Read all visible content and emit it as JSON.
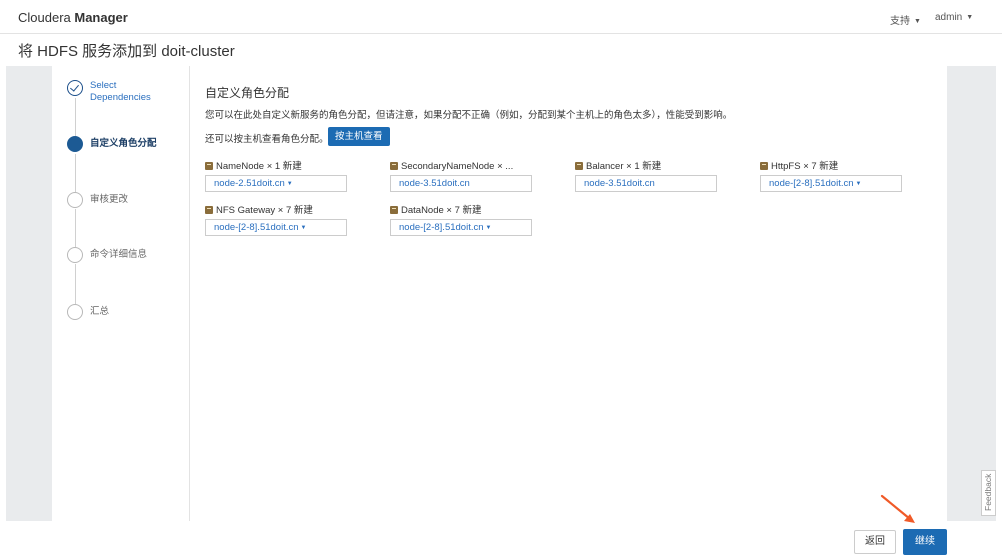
{
  "header": {
    "brand_light": "Cloudera ",
    "brand_bold": "Manager",
    "support_label": "支持",
    "user_label": "admin"
  },
  "page": {
    "title": "将 HDFS 服务添加到 doit-cluster"
  },
  "steps": [
    {
      "label_line1": "Select",
      "label_line2": "Dependencies",
      "state": "done"
    },
    {
      "label": "自定义角色分配",
      "state": "active"
    },
    {
      "label": "审核更改",
      "state": "pending"
    },
    {
      "label": "命令详细信息",
      "state": "pending"
    },
    {
      "label": "汇总",
      "state": "pending"
    }
  ],
  "content": {
    "section_title": "自定义角色分配",
    "description": "您可以在此处自定义新服务的角色分配，但请注意，如果分配不正确（例如，分配到某个主机上的角色太多），性能受到影响。",
    "host_view_text": "还可以按主机查看角色分配。",
    "host_view_button": "按主机查看"
  },
  "roles": [
    {
      "name": "NameNode × 1 新建",
      "host": "node-2.51doit.cn",
      "dropdown": true
    },
    {
      "name": "SecondaryNameNode × ...",
      "host": "node-3.51doit.cn",
      "dropdown": false
    },
    {
      "name": "Balancer × 1 新建",
      "host": "node-3.51doit.cn",
      "dropdown": false
    },
    {
      "name": "HttpFS × 7 新建",
      "host": "node-[2-8].51doit.cn",
      "dropdown": true
    },
    {
      "name": "NFS Gateway × 7 新建",
      "host": "node-[2-8].51doit.cn",
      "dropdown": true
    },
    {
      "name": "DataNode × 7 新建",
      "host": "node-[2-8].51doit.cn",
      "dropdown": true
    }
  ],
  "footer": {
    "back_label": "返回",
    "continue_label": "继续",
    "feedback_label": "Feedback"
  },
  "colors": {
    "primary": "#1c6bb3",
    "link": "#2a6fbf",
    "sidebar_gray": "#e9ebed",
    "arrow": "#f05a28"
  },
  "icons": {
    "role": "role-icon",
    "check": "check-circle-icon",
    "caret": "caret-down-icon"
  }
}
